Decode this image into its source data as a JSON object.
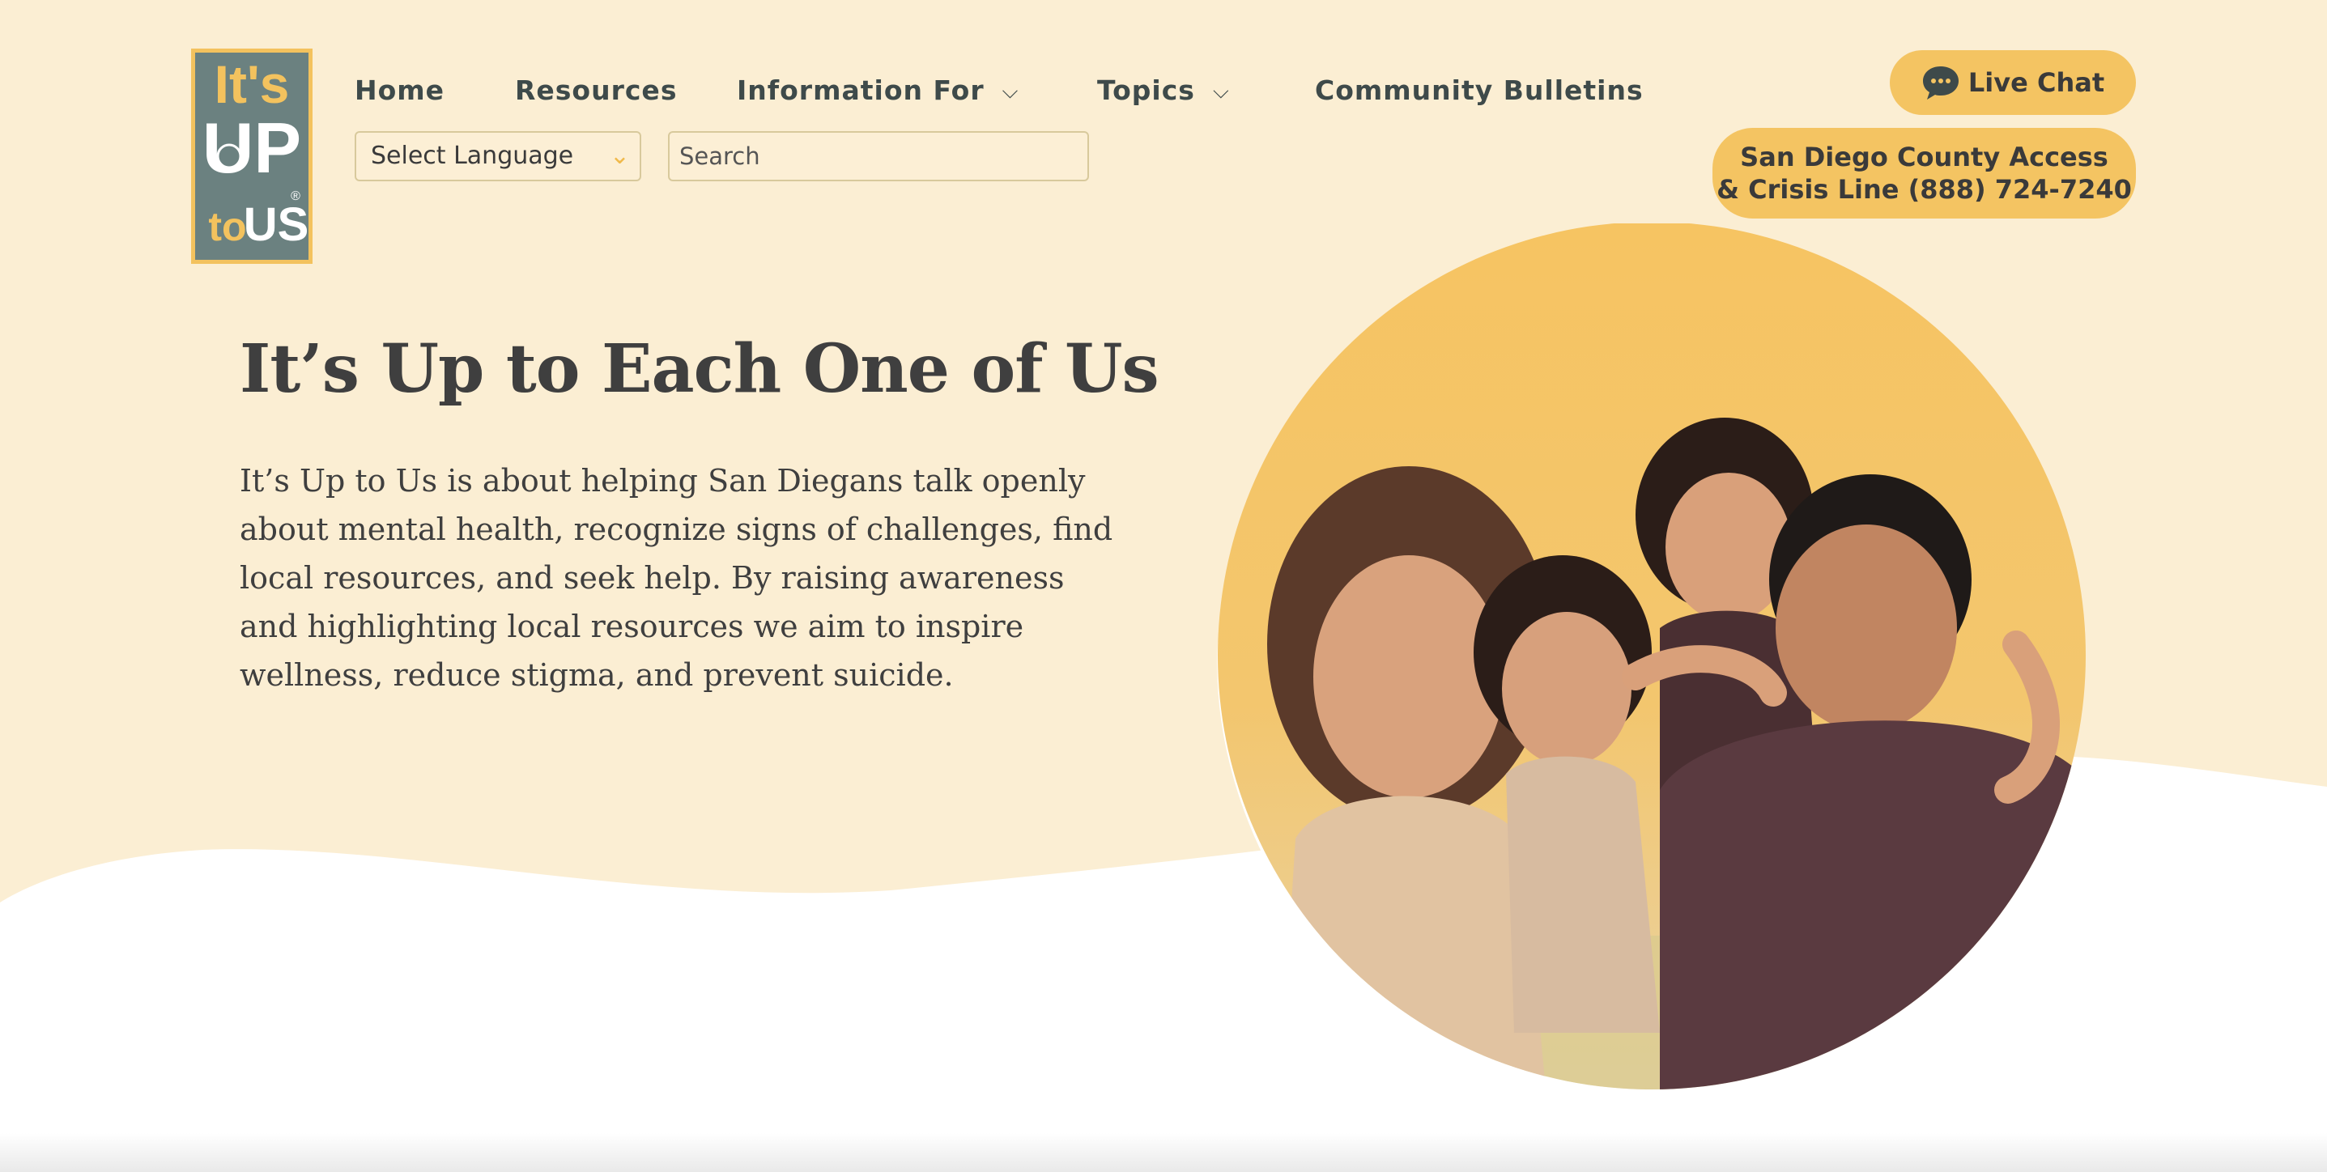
{
  "brand": {
    "logo_alt": "It's Up to Us",
    "logo_line1": "It's",
    "logo_line2": "UP",
    "logo_line3": "to",
    "logo_line4": "US",
    "color_slate": "#6b8180",
    "color_gold": "#f3c25e"
  },
  "nav": {
    "items": [
      {
        "label": "Home"
      },
      {
        "label": "Resources"
      },
      {
        "label": "Information For",
        "has_dropdown": true
      },
      {
        "label": "Topics",
        "has_dropdown": true
      },
      {
        "label": "Community Bulletins"
      }
    ]
  },
  "language": {
    "label": "Select Language",
    "icon": "chevron-down-icon"
  },
  "search": {
    "placeholder": "Search",
    "value": ""
  },
  "live_chat": {
    "label": "Live Chat",
    "icon": "chat-bubble-icon"
  },
  "crisis_line": {
    "line1": "San Diego County Access",
    "line2": "& Crisis Line (888) 724-7240"
  },
  "hero": {
    "title": "It’s Up to Each One of Us",
    "body": "It’s Up to Us is about helping San Diegans talk openly about mental health, recognize signs of challenges, find local resources, and seek help. By raising awareness and highlighting local resources we aim to inspire wellness, reduce stigma, and prevent suicide."
  },
  "colors": {
    "cream": "#fbeed3",
    "accent": "#f4c462",
    "text": "#3f3f3f",
    "nav_text": "#3e4a4a"
  }
}
